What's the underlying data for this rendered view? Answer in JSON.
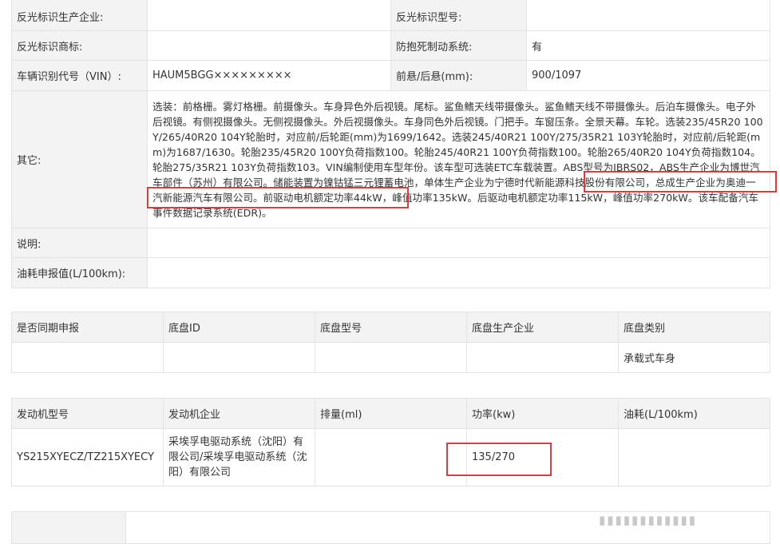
{
  "main": {
    "rows": [
      {
        "label1": "反光标识生产企业:",
        "value1": "",
        "label2": "反光标识型号:",
        "value2": ""
      },
      {
        "label1": "反光标识商标:",
        "value1": "",
        "label2": "防抱死制动系统:",
        "value2": "有"
      },
      {
        "label1": "车辆识别代号（VIN）:",
        "value1": "HAUM5BGG×××××××××",
        "label2": "前悬/后悬(mm):",
        "value2": "900/1097"
      }
    ],
    "other_label": "其它:",
    "other_text": "选装：前格栅。雾灯格栅。前摄像头。车身异色外后视镜。尾标。鲨鱼鳍天线带摄像头。鲨鱼鳍天线不带摄像头。后泊车摄像头。电子外后视镜。有侧视摄像头。无侧视摄像头。外后视摄像头。车身同色外后视镜。门把手。车窗压条。全景天幕。车轮。选装235/45R20 100Y/265/40R20 104Y轮胎时，对应前/后轮距(mm)为1699/1642。选装245/40R21 100Y/275/35R21 103Y轮胎时，对应前/后轮距(mm)为1687/1630。轮胎235/45R20 100Y负荷指数100。轮胎245/40R21 100Y负荷指数100。轮胎265/40R20 104Y负荷指数104。轮胎275/35R21 103Y负荷指数103。VIN编制使用车型年份。该车型可选装ETC车载装置。ABS型号为IBRS02，ABS生产企业为博世汽车部件（苏州）有限公司。储能装置为镍钴锰三元锂蓄电池，单体生产企业为宁德时代新能源科技股份有限公司，总成生产企业为奥迪一汽新能源汽车有限公司。前驱动电机额定功率44kW，峰值功率135kW。后驱动电机额定功率115kW，峰值功率270kW。该车配备汽车事件数据记录系统(EDR)。",
    "note_label": "说明:",
    "note_value": "",
    "fuel_label": "油耗申报值(L/100km):",
    "fuel_value": ""
  },
  "chassis": {
    "headers": [
      "是否同期申报",
      "底盘ID",
      "底盘型号",
      "底盘生产企业",
      "底盘类别"
    ],
    "row": [
      "",
      "",
      "",
      "",
      "承载式车身"
    ]
  },
  "engine": {
    "headers": [
      "发动机型号",
      "发动机企业",
      "排量(ml)",
      "功率(kw)",
      "油耗(L/100km)"
    ],
    "row": [
      "YS215XYECZ/TZ215XYECY",
      "采埃孚电驱动系统（沈阳）有限公司/采埃孚电驱动系统（沈阳）有限公司",
      "",
      "135/270",
      ""
    ]
  },
  "highlight_color": "#e0383e"
}
